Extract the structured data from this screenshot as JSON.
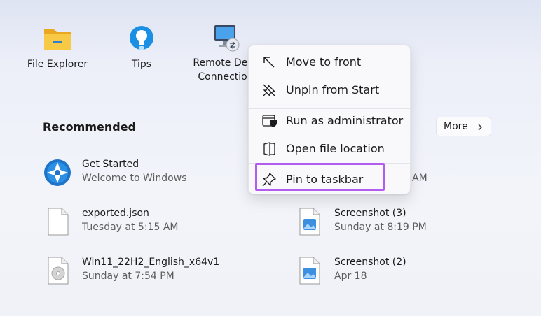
{
  "pinned": [
    {
      "label": "File Explorer",
      "icon": "folder-icon"
    },
    {
      "label": "Tips",
      "icon": "lightbulb-icon"
    },
    {
      "label": "Remote Desk Connection",
      "line1": "Remote Desk",
      "line2": "Connection",
      "icon": "remote-desktop-icon"
    }
  ],
  "recommended": {
    "title": "Recommended",
    "more_label": "More",
    "items": [
      {
        "name": "Get Started",
        "sub": "Welcome to Windows",
        "icon": "get-started-icon"
      },
      {
        "name": "",
        "sub": "AM",
        "icon": "image-file-icon"
      },
      {
        "name": "exported.json",
        "sub": "Tuesday at 5:15 AM",
        "icon": "document-icon"
      },
      {
        "name": "Screenshot (3)",
        "sub": "Sunday at 8:19 PM",
        "icon": "image-file-icon"
      },
      {
        "name": "Win11_22H2_English_x64v1",
        "sub": "Sunday at 7:54 PM",
        "icon": "disc-image-icon"
      },
      {
        "name": "Screenshot (2)",
        "sub": "Apr 18",
        "icon": "image-file-icon"
      }
    ]
  },
  "context_menu": {
    "items": [
      {
        "label": "Move to front",
        "icon": "arrow-up-left-icon"
      },
      {
        "label": "Unpin from Start",
        "icon": "unpin-icon"
      },
      {
        "label": "Run as administrator",
        "icon": "shield-window-icon"
      },
      {
        "label": "Open file location",
        "icon": "folder-open-icon"
      },
      {
        "label": "Pin to taskbar",
        "icon": "pin-icon"
      }
    ],
    "highlight_color": "#b25cf0"
  },
  "colors": {
    "folder_yellow": "#f5c431",
    "tips_blue": "#1a8fe3",
    "menu_bg": "#f9f9fb"
  }
}
